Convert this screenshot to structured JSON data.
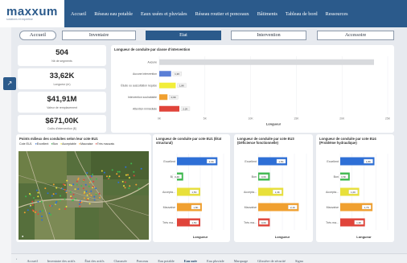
{
  "logo": {
    "word": "maxxum",
    "tagline": "solutions et expertise"
  },
  "nav": [
    "Accueil",
    "Réseau eau potable",
    "Eaux usées et pluviales",
    "Réseau routier et ponceaux",
    "Bâtiments",
    "Tableau de bord",
    "Ressources"
  ],
  "tabs": [
    "Accueil",
    "Inventaire",
    "Etat",
    "Intervention",
    "Accessoire"
  ],
  "kpis": [
    {
      "value": "504",
      "label": "Nb de segments"
    },
    {
      "value": "33,62K",
      "label": "Longueur (m)"
    },
    {
      "value": "$41,91M",
      "label": "Valeur de remplacement"
    },
    {
      "value": "$671,00K",
      "label": "Coûts d'intervention ($)"
    }
  ],
  "main_chart": {
    "title": "Longueur de conduite par classe d'intervention",
    "xlabel": "Longueur",
    "ticks": [
      "0K",
      "5K",
      "10K",
      "15K",
      "20K",
      "25K"
    ]
  },
  "map": {
    "title": "Points milieux des conduites selon leur cote EU1",
    "legend_label": "Cote EU1",
    "legend": [
      {
        "label": "Excellent",
        "color": "#2e6fd6"
      },
      {
        "label": "Bon",
        "color": "#3fb950"
      },
      {
        "label": "Acceptable",
        "color": "#e8e03a"
      },
      {
        "label": "Mauvaise",
        "color": "#f0a030"
      },
      {
        "label": "Très mauvais",
        "color": "#e0443a"
      }
    ]
  },
  "mini_charts": [
    {
      "title": "Longueur de conduite par cote EU1 (État structural)",
      "xlabel": "Longueur"
    },
    {
      "title": "Longueur de conduite par cote EU3 (Déficience fonctionnelle)",
      "xlabel": "Longueur"
    },
    {
      "title": "Longueur de conduite par cote EU4 (Problème hydraulique)",
      "xlabel": "Longueur"
    }
  ],
  "chart_data": [
    {
      "type": "bar",
      "title": "Longueur de conduite par classe d'intervention",
      "xlabel": "Longueur",
      "categories": [
        "Aucune",
        "Aucune intervention",
        "Étude ou auscultation requise",
        "Intervention souhaitable",
        "Attention immédiate"
      ],
      "values": [
        23.5,
        1.3,
        1.8,
        0.9,
        2.2
      ],
      "value_labels": [
        "",
        "1,3K",
        "1,8K",
        "0,9K",
        "2,2K"
      ],
      "colors": [
        "#d8dadd",
        "#5b7fd6",
        "#f2ee3a",
        "#f0a030",
        "#e0443a"
      ],
      "xlim": [
        0,
        25
      ]
    },
    {
      "type": "bar",
      "title": "Longueur de conduite par cote EU1 (État structural)",
      "xlabel": "Longueur",
      "categories": [
        "Excellent",
        "Bon",
        "Accepta...",
        "Mauvaise",
        "Très ma..."
      ],
      "values": [
        2.6,
        0.4,
        1.5,
        1.6,
        1.5
      ],
      "value_labels": [
        "2,6K",
        "0,4K",
        "1,5K",
        "1,6K",
        "1,5K"
      ],
      "colors": [
        "#2e6fd6",
        "#3fb950",
        "#e8e03a",
        "#f0a030",
        "#e0443a"
      ],
      "xlim": [
        0,
        3
      ]
    },
    {
      "type": "bar",
      "title": "Longueur de conduite par cote EU3 (Déficience fonctionnelle)",
      "xlabel": "Longueur",
      "categories": [
        "Excellent",
        "Bon",
        "Accepta...",
        "Mauvaise",
        "Très ma..."
      ],
      "values": [
        1.5,
        0.6,
        1.3,
        2.1,
        0.6
      ],
      "value_labels": [
        "1,5K",
        "0,6K",
        "1,3K",
        "2,1K",
        "0,6K"
      ],
      "colors": [
        "#2e6fd6",
        "#3fb950",
        "#e8e03a",
        "#f0a030",
        "#e0443a"
      ],
      "xlim": [
        0,
        2.5
      ]
    },
    {
      "type": "bar",
      "title": "Longueur de conduite par cote EU4 (Problème hydraulique)",
      "xlabel": "Longueur",
      "categories": [
        "Excellent",
        "Bon",
        "Accepta...",
        "Mauvaise",
        "Très ma..."
      ],
      "values": [
        1.8,
        0.5,
        1.0,
        1.7,
        1.3
      ],
      "value_labels": [
        "1,8K",
        "0,5K",
        "1,0K",
        "1,7K",
        "1,3K"
      ],
      "colors": [
        "#2e6fd6",
        "#3fb950",
        "#e8e03a",
        "#f0a030",
        "#e0443a"
      ],
      "xlim": [
        0,
        2.5
      ]
    }
  ],
  "bottom_tabs": [
    "Accueil",
    "Inventaire des actifs",
    "État des actifs",
    "Chaussée",
    "Ponceau",
    "Eau potable",
    "Eau usée",
    "Eau pluviale",
    "Marquage",
    "Glissière de sécurité",
    "Signa"
  ],
  "bottom_active": "Eau usée"
}
